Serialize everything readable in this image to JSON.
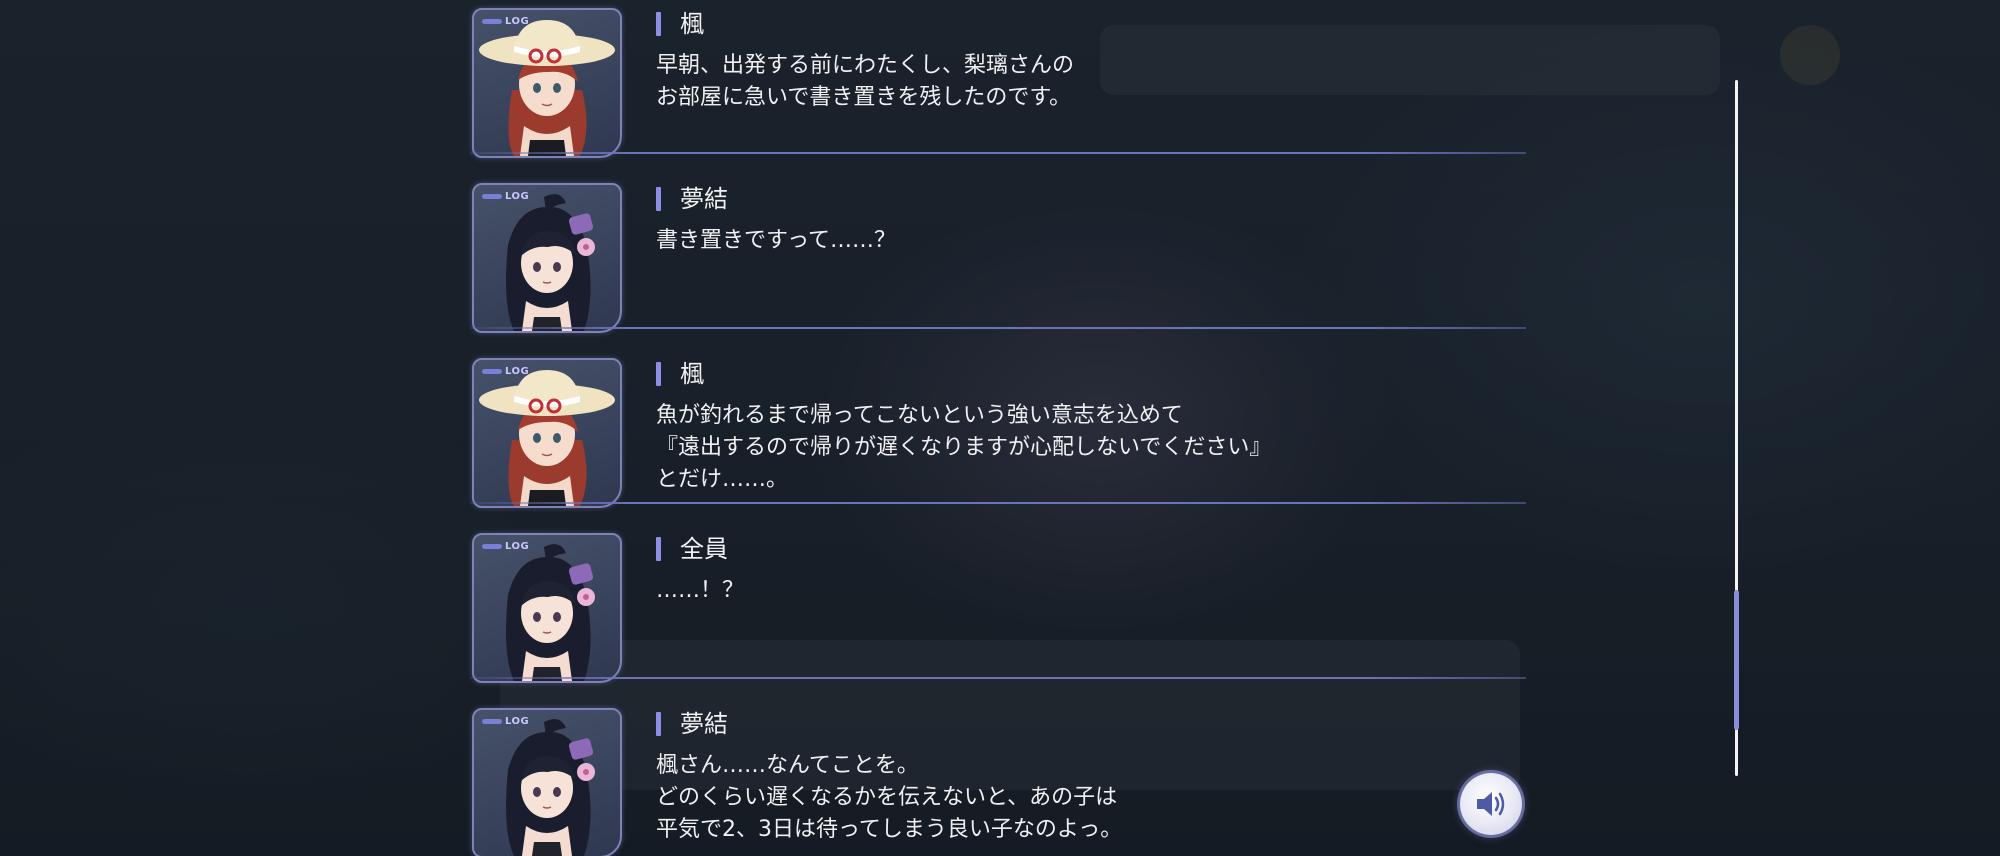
{
  "log_tag": "LOG",
  "entries": [
    {
      "speaker": "楓",
      "portrait": "kaede-portrait",
      "lines": [
        "早朝、出発する前にわたくし、梨璃さんの",
        "お部屋に急いで書き置きを残したのです。"
      ]
    },
    {
      "speaker": "夢結",
      "portrait": "yuyu-portrait",
      "lines": [
        "書き置きですって……？"
      ]
    },
    {
      "speaker": "楓",
      "portrait": "kaede-portrait",
      "lines": [
        "魚が釣れるまで帰ってこないという強い意志を込めて",
        "『遠出するので帰りが遅くなりますが心配しないでください』",
        "とだけ……。"
      ]
    },
    {
      "speaker": "全員",
      "portrait": "yuyu-portrait",
      "lines": [
        "……！？"
      ]
    },
    {
      "speaker": "夢結",
      "portrait": "yuyu-portrait",
      "lines": [
        "楓さん……なんてことを。",
        "どのくらい遅くなるかを伝えないと、あの子は",
        "平気で2、3日は待ってしまう良い子なのよっ。"
      ]
    }
  ],
  "voice_button": {
    "icon": "speaker-icon"
  },
  "colors": {
    "accent": "#8d8fe6",
    "divider": "#6c74b8",
    "text": "#f0f0f2"
  }
}
